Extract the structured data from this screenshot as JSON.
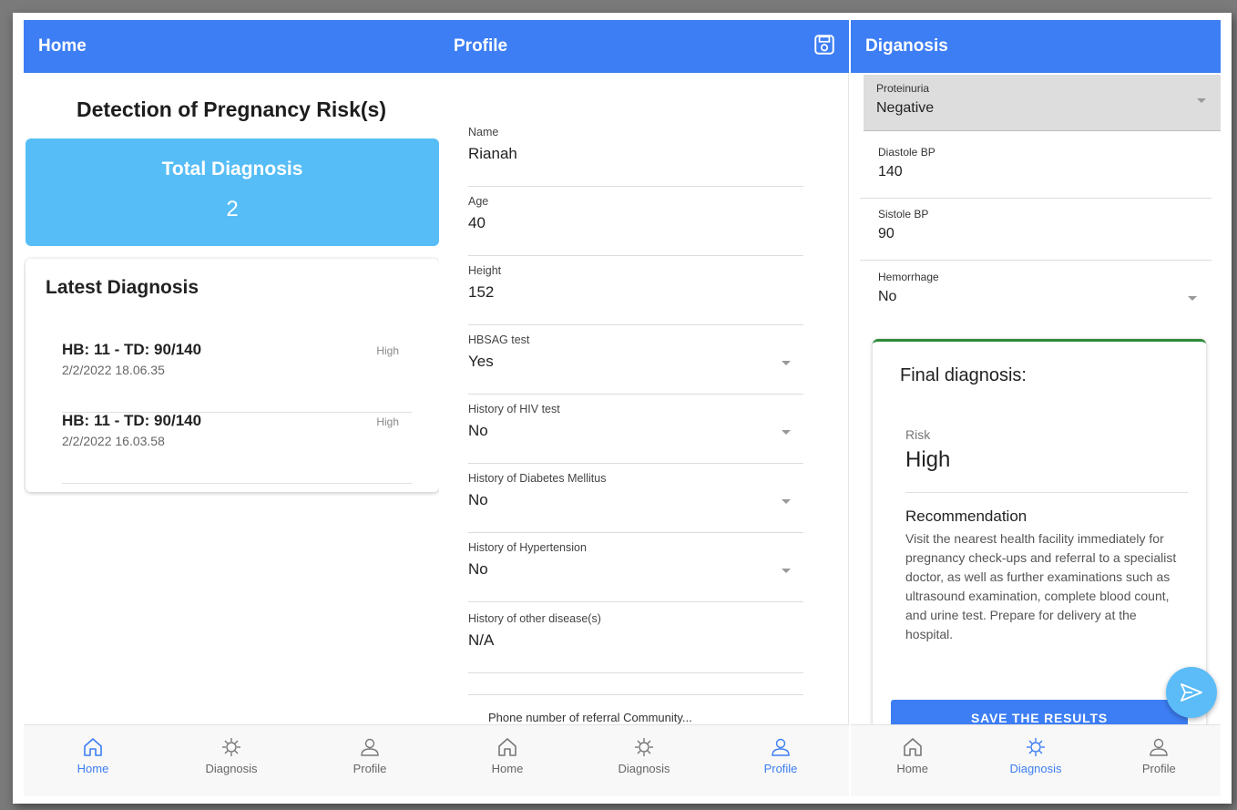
{
  "home": {
    "appbar_title": "Home",
    "heading": "Detection of Pregnancy Risk(s)",
    "total_label": "Total Diagnosis",
    "total_value": "2",
    "latest_title": "Latest Diagnosis",
    "items": [
      {
        "title": "HB: 11 - TD: 90/140",
        "date": "2/2/2022 18.06.35",
        "risk": "High"
      },
      {
        "title": "HB: 11 - TD: 90/140",
        "date": "2/2/2022 16.03.58",
        "risk": "High"
      }
    ]
  },
  "profile": {
    "appbar_title": "Profile",
    "save_icon": "save-icon",
    "fields": [
      {
        "label": "Name",
        "value": "Rianah"
      },
      {
        "label": "Age",
        "value": "40"
      },
      {
        "label": "Height",
        "value": "152"
      },
      {
        "label": "HBSAG test",
        "value": "Yes"
      },
      {
        "label": "History of HIV test",
        "value": "No"
      },
      {
        "label": "History of Diabetes Mellitus",
        "value": "No"
      },
      {
        "label": "History of Hypertension",
        "value": "No"
      },
      {
        "label": "History of other disease(s)",
        "value": "N/A"
      }
    ],
    "phone_label": "Phone number of referral Community..."
  },
  "diagnosis": {
    "appbar_title": "Diganosis",
    "fields": [
      {
        "label": "Proteinuria",
        "value": "Negative"
      },
      {
        "label": "Diastole BP",
        "value": "140"
      },
      {
        "label": "Sistole BP",
        "value": "90"
      },
      {
        "label": "Hemorrhage",
        "value": "No"
      }
    ],
    "final_title": "Final diagnosis:",
    "risk_label": "Risk",
    "risk_value": "High",
    "recommendation_label": "Recommendation",
    "recommendation_text": "Visit the nearest health facility immediately for pregnancy check-ups and referral to a specialist doctor, as well as further examinations such as ultrasound examination, complete blood count, and urine test. Prepare for delivery at the hospital.",
    "save_button": "SAVE THE RESULTS"
  },
  "nav": {
    "home": "Home",
    "diagnosis": "Diagnosis",
    "profile": "Profile"
  },
  "colors": {
    "primary": "#3d7ef4",
    "card_blue": "#56bdf6",
    "accent_green": "#2e8b3a"
  }
}
